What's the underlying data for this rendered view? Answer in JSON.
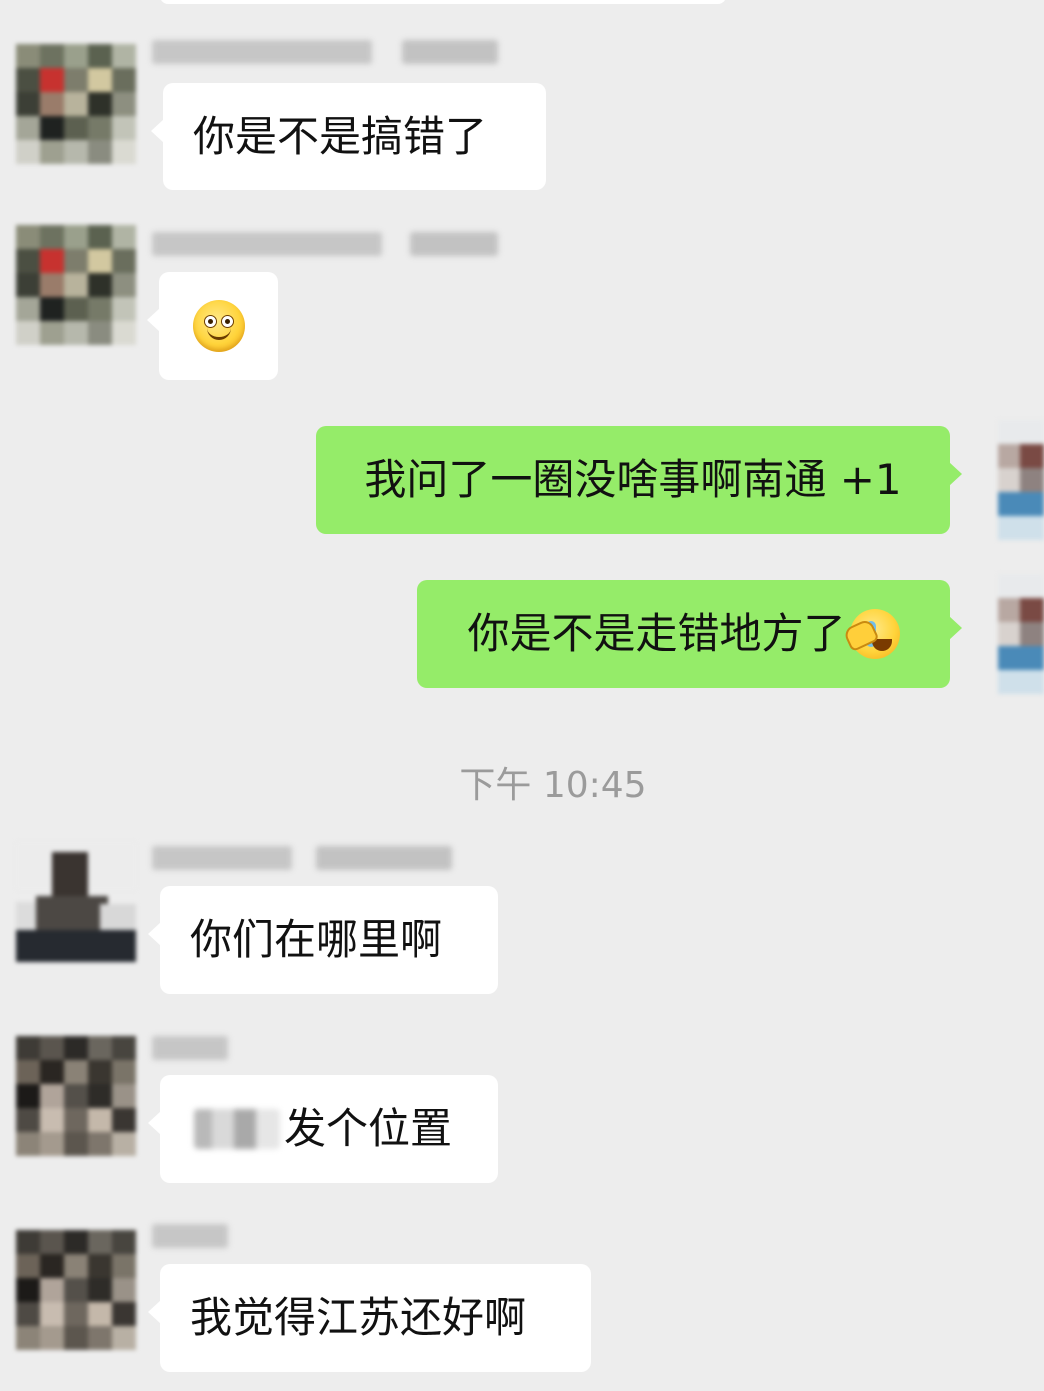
{
  "messages": [
    {
      "side": "in",
      "text": "你是不是搞错了"
    },
    {
      "side": "in",
      "emoji": "smile-emoji"
    },
    {
      "side": "out",
      "text": "我问了一圈没啥事啊南通 +1"
    },
    {
      "side": "out",
      "text": "你是不是走错地方了",
      "emoji": "facepalm-cry-emoji"
    },
    {
      "side": "in",
      "text": "你们在哪里啊"
    },
    {
      "side": "in",
      "text": "发个位置"
    },
    {
      "side": "in",
      "text": "我觉得江苏还好啊"
    }
  ],
  "timestamp": "下午 10:45",
  "colors": {
    "background": "#ededed",
    "incoming_bubble": "#ffffff",
    "outgoing_bubble": "#95ec69",
    "timestamp": "#9b9b9b"
  }
}
